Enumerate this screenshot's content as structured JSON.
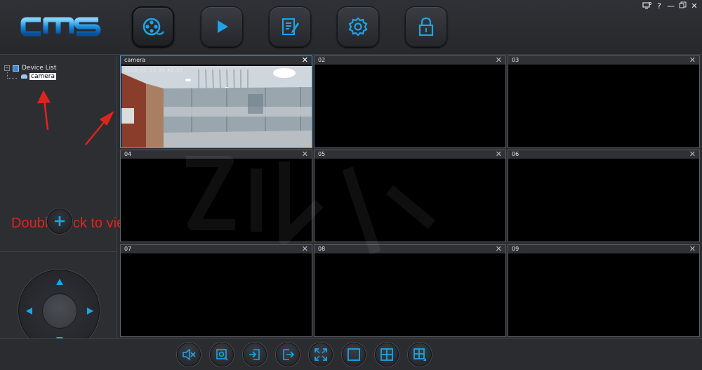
{
  "app": {
    "logo_text": "cms"
  },
  "header": {
    "nav": [
      {
        "id": "live-view",
        "icon": "film-reel-icon",
        "active": true
      },
      {
        "id": "playback",
        "icon": "play-icon",
        "active": false
      },
      {
        "id": "log",
        "icon": "notepad-pen-icon",
        "active": false
      },
      {
        "id": "settings",
        "icon": "gear-icon",
        "active": false
      },
      {
        "id": "lock",
        "icon": "padlock-icon",
        "active": false
      }
    ],
    "window_controls": {
      "help": "?",
      "minimize": "—",
      "close": "✕"
    }
  },
  "sidebar": {
    "tree": {
      "toggle": "−",
      "root_label": "Device List",
      "children": [
        {
          "label": "camera",
          "selected": true
        }
      ]
    },
    "annotation": "Double click to view",
    "add_button_icon": "plus-icon"
  },
  "grid": {
    "tiles": [
      {
        "label": "camera",
        "selected": true,
        "has_video": true,
        "osd": "2018-05-22  09:42:39"
      },
      {
        "label": "02"
      },
      {
        "label": "03"
      },
      {
        "label": "04"
      },
      {
        "label": "05"
      },
      {
        "label": "06"
      },
      {
        "label": "07"
      },
      {
        "label": "08"
      },
      {
        "label": "09"
      }
    ],
    "close_glyph": "✕"
  },
  "toolbar": {
    "buttons": [
      {
        "id": "mute",
        "icon": "speaker-mute-icon"
      },
      {
        "id": "snapshot",
        "icon": "snapshot-icon"
      },
      {
        "id": "import",
        "icon": "import-icon"
      },
      {
        "id": "export",
        "icon": "export-icon"
      },
      {
        "id": "fullscreen",
        "icon": "fullscreen-icon"
      },
      {
        "id": "layout-1",
        "icon": "layout-single-icon"
      },
      {
        "id": "layout-4",
        "icon": "layout-quad-icon"
      },
      {
        "id": "layout-custom",
        "icon": "layout-custom-icon"
      }
    ]
  },
  "colors": {
    "accent": "#1fa3e8",
    "annotation": "#e0241c",
    "selected_border": "#3fa2e6"
  }
}
